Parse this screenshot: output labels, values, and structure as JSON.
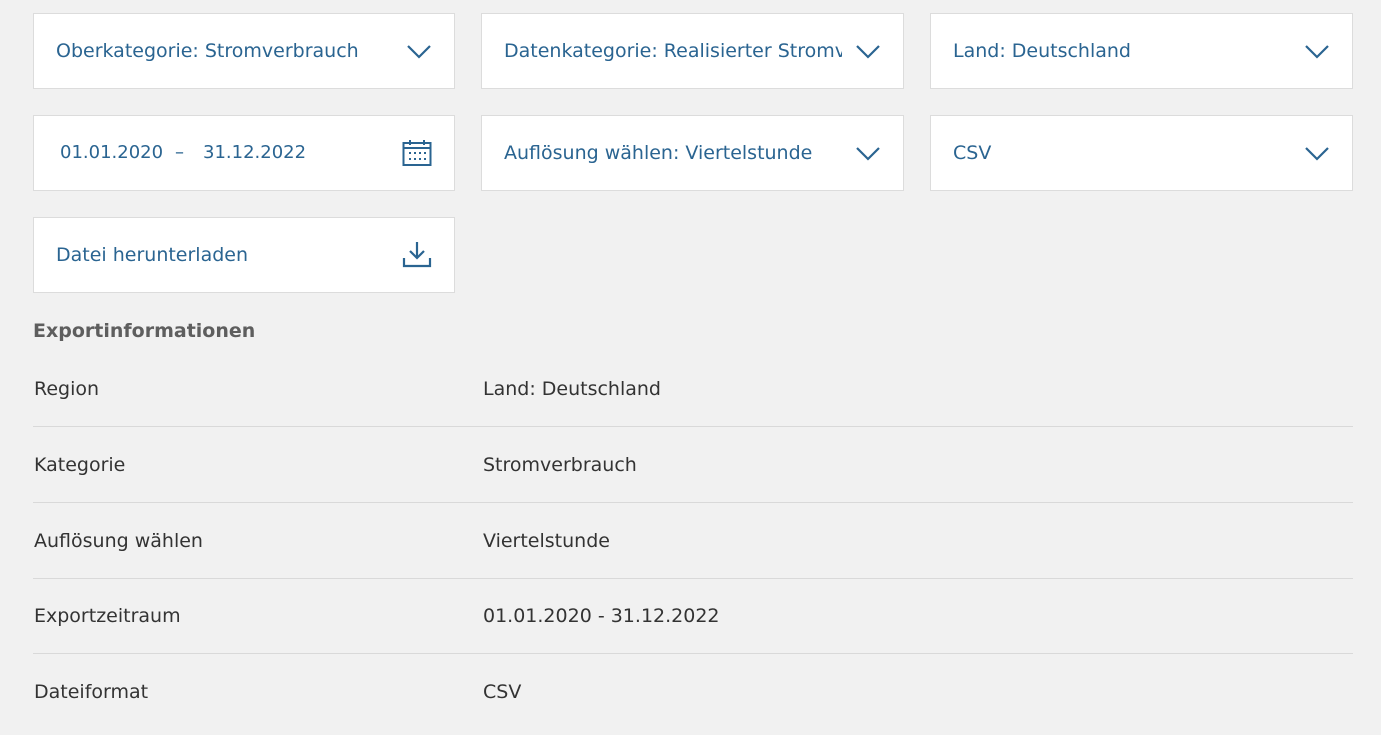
{
  "filters": {
    "oberkategorie": "Oberkategorie: Stromverbrauch",
    "datenkategorie": "Datenkategorie: Realisierter Stromverbrauch",
    "land": "Land: Deutschland",
    "date_from": "01.01.2020",
    "date_separator": "–",
    "date_to": "31.12.2022",
    "aufloesung": "Auflösung wählen: Viertelstunde",
    "format": "CSV"
  },
  "download": {
    "label": "Datei herunterladen"
  },
  "export_info": {
    "title": "Exportinformationen",
    "rows": [
      {
        "key": "Region",
        "value": "Land: Deutschland"
      },
      {
        "key": "Kategorie",
        "value": "Stromverbrauch"
      },
      {
        "key": "Auflösung wählen",
        "value": "Viertelstunde"
      },
      {
        "key": "Exportzeitraum",
        "value": "01.01.2020 - 31.12.2022"
      },
      {
        "key": "Dateiformat",
        "value": "CSV"
      }
    ]
  },
  "colors": {
    "accent": "#2a6491",
    "background": "#f1f1f1",
    "text": "#333333"
  },
  "icons": [
    "chevron-down-icon",
    "calendar-icon",
    "download-icon"
  ]
}
